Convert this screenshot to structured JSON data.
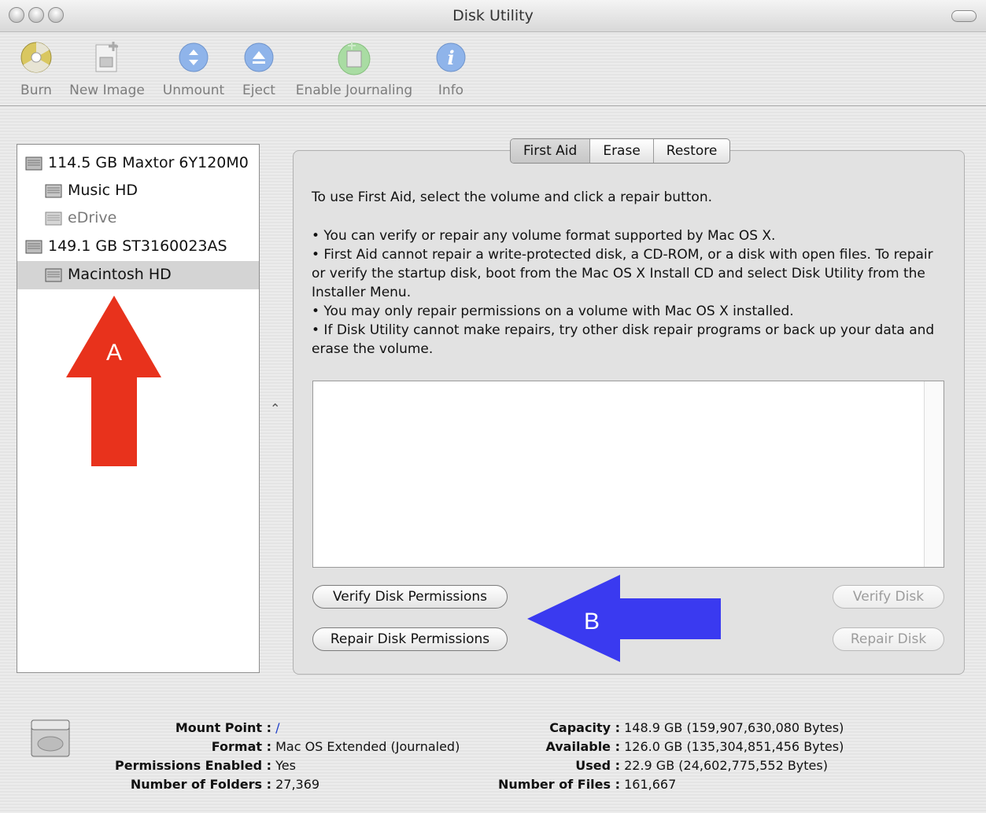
{
  "window": {
    "title": "Disk Utility"
  },
  "toolbar": {
    "items": [
      {
        "label": "Burn",
        "icon": "burn-icon"
      },
      {
        "label": "New Image",
        "icon": "new-image-icon"
      },
      {
        "label": "Unmount",
        "icon": "unmount-icon"
      },
      {
        "label": "Eject",
        "icon": "eject-icon"
      },
      {
        "label": "Enable Journaling",
        "icon": "journaling-icon"
      },
      {
        "label": "Info",
        "icon": "info-icon"
      }
    ]
  },
  "sidebar": {
    "items": [
      {
        "label": "114.5 GB Maxtor 6Y120M0",
        "type": "disk"
      },
      {
        "label": "Music HD",
        "type": "volume"
      },
      {
        "label": "eDrive",
        "type": "volume",
        "dimmed": true
      },
      {
        "label": "149.1 GB ST3160023AS",
        "type": "disk"
      },
      {
        "label": "Macintosh HD",
        "type": "volume",
        "selected": true
      }
    ]
  },
  "tabs": [
    {
      "label": "First Aid",
      "active": true
    },
    {
      "label": "Erase"
    },
    {
      "label": "Restore"
    }
  ],
  "first_aid": {
    "intro": "To use First Aid, select the volume and click a repair button.",
    "bullets": [
      "• You can verify or repair any volume format supported by Mac OS X.",
      "• First Aid cannot repair a write-protected disk, a CD-ROM, or a disk with open files. To repair or verify the startup disk, boot from the Mac OS X Install CD and select Disk Utility from the Installer Menu.",
      "• You may only repair permissions on a volume with Mac OS X installed.",
      "• If Disk Utility cannot make repairs, try other disk repair programs or back up your data and erase the volume."
    ],
    "verify_permissions": "Verify Disk Permissions",
    "repair_permissions": "Repair Disk Permissions",
    "verify_disk": "Verify Disk",
    "repair_disk": "Repair Disk"
  },
  "annotations": {
    "a": "A",
    "b": "B",
    "a_color": "#e8321c",
    "b_color": "#3a3af0"
  },
  "info": {
    "left": [
      {
        "key": "Mount Point :",
        "value": "/",
        "link": true
      },
      {
        "key": "Format :",
        "value": "Mac OS Extended (Journaled)"
      },
      {
        "key": "Permissions Enabled :",
        "value": "Yes"
      },
      {
        "key": "Number of Folders :",
        "value": "27,369"
      }
    ],
    "right": [
      {
        "key": "Capacity :",
        "value": "148.9 GB (159,907,630,080 Bytes)"
      },
      {
        "key": "Available :",
        "value": "126.0 GB (135,304,851,456 Bytes)"
      },
      {
        "key": "Used :",
        "value": "22.9 GB (24,602,775,552 Bytes)"
      },
      {
        "key": "Number of Files :",
        "value": "161,667"
      }
    ]
  }
}
